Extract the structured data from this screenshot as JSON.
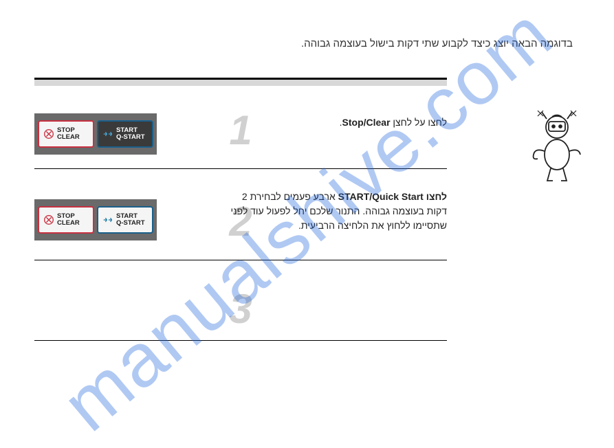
{
  "watermark": "manualshive.com",
  "intro": "בדוגמה הבאה יוצג כיצד לקבוע שתי דקות בישול בעוצמה גבוהה.",
  "steps": {
    "s1": {
      "num": "1",
      "prefix": "לחצו על לחצן ",
      "bold": "Stop/Clear",
      "suffix": "."
    },
    "s2": {
      "num": "2",
      "prefix": "לחצו",
      "bold": "START/Quick Start",
      "mid": " ארבע פעמים לבחירת 2 דקות בעוצמה גבוהה. התנור שלכם יחל לפעול עוד לפני שתסיימו ללחוץ את הלחיצה הרביעית."
    },
    "s3": {
      "num": "3"
    }
  },
  "buttons": {
    "stop_l1": "STOP",
    "stop_l2": "CLEAR",
    "start_l1": "START",
    "start_l2": "Q-START"
  }
}
